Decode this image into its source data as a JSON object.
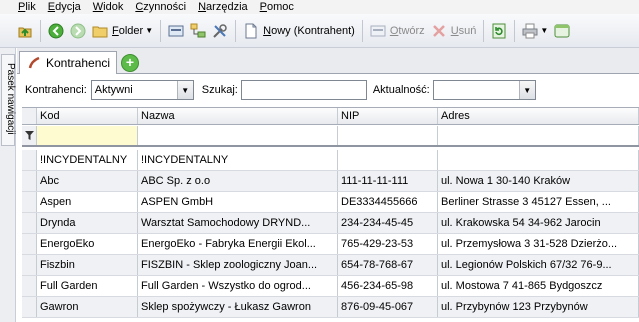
{
  "menu": [
    {
      "label": "Plik",
      "key": "P",
      "rest": "lik"
    },
    {
      "label": "Edycja",
      "key": "E",
      "rest": "dycja"
    },
    {
      "label": "Widok",
      "key": "W",
      "rest": "idok"
    },
    {
      "label": "Czynności",
      "key": "C",
      "rest": "zynności"
    },
    {
      "label": "Narzędzia",
      "key": "N",
      "rest": "arzędzia"
    },
    {
      "label": "Pomoc",
      "key": "P",
      "rest": "omoc"
    }
  ],
  "toolbar": {
    "folder_key": "F",
    "folder_rest": "older",
    "new_key": "N",
    "new_rest": "owy (Kontrahent)",
    "open_key": "O",
    "open_rest": "twórz",
    "delete_key": "U",
    "delete_rest": "suń"
  },
  "nav": {
    "label": "Pasek nawigacji"
  },
  "tab": {
    "label": "Kontrahenci"
  },
  "filters": {
    "kontrahenci_label": "Kontrahenci:",
    "kontrahenci_value": "Aktywni",
    "szukaj_label": "Szukaj:",
    "szukaj_value": "",
    "aktualnosc_label": "Aktualność:",
    "aktualnosc_value": ""
  },
  "grid": {
    "columns": [
      "Kod",
      "Nazwa",
      "NIP",
      "Adres"
    ],
    "rows": [
      [
        "!INCYDENTALNY",
        "!INCYDENTALNY",
        "",
        ""
      ],
      [
        "Abc",
        "ABC Sp. z o.o",
        "111-11-11-111",
        "ul. Nowa 1 30-140 Kraków"
      ],
      [
        "Aspen",
        "ASPEN GmbH",
        "DE3334455666",
        "Berliner Strasse 3  45127 Essen, ..."
      ],
      [
        "Drynda",
        "Warsztat Samochodowy DRYND...",
        "234-234-45-45",
        "ul. Krakowska 54 34-962 Jarocin"
      ],
      [
        "EnergoEko",
        "EnergoEko - Fabryka Energii Ekol...",
        "765-429-23-53",
        "ul. Przemysłowa 3 31-528 Dzierżo..."
      ],
      [
        "Fiszbin",
        "FISZBIN - Sklep zoologiczny Joan...",
        "654-78-768-67",
        "ul. Legionów Polskich 67/32 76-9..."
      ],
      [
        "Full Garden",
        "Full Garden - Wszystko do ogrod...",
        "456-234-65-98",
        "ul. Mostowa 7 41-865 Bydgoszcz"
      ],
      [
        "Gawron",
        "Sklep spożywczy - Łukasz Gawron",
        "876-09-45-067",
        "ul. Przybynów 123  Przybynów"
      ]
    ]
  }
}
